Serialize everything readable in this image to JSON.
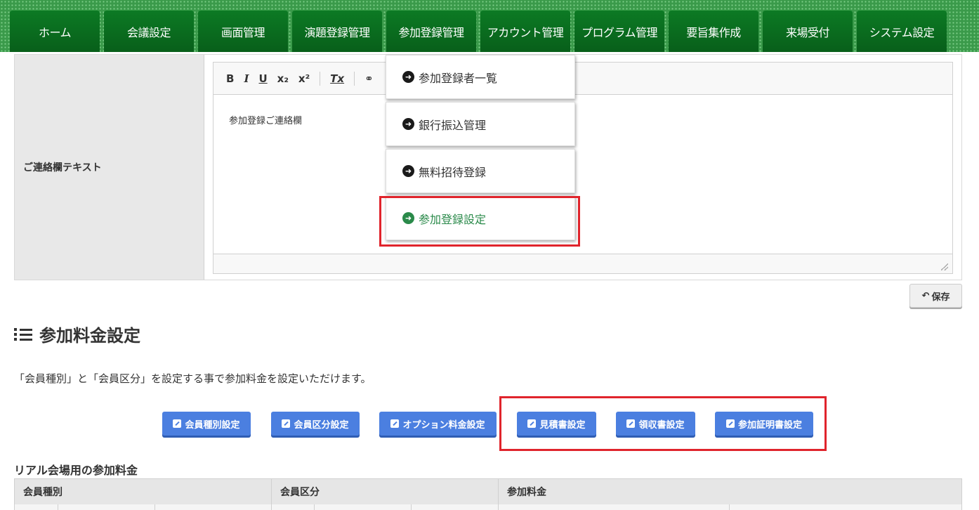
{
  "nav": {
    "items": [
      "ホーム",
      "会議設定",
      "画面管理",
      "演題登録管理",
      "参加登録管理",
      "アカウント管理",
      "プログラム管理",
      "要旨集作成",
      "来場受付",
      "システム設定"
    ]
  },
  "editor": {
    "label": "ご連絡欄テキスト",
    "toolbar": [
      "B",
      "I",
      "U",
      "x₂",
      "x²",
      "Tx",
      "⚭"
    ],
    "content": "参加登録ご連絡欄"
  },
  "dropdown": {
    "items": [
      {
        "label": "参加登録者一覧",
        "active": false
      },
      {
        "label": "銀行振込管理",
        "active": false
      },
      {
        "label": "無料招待登録",
        "active": false
      },
      {
        "label": "参加登録設定",
        "active": true
      }
    ]
  },
  "save_label": "保存",
  "section_title": "参加料金設定",
  "description": "「会員種別」と「会員区分」を設定する事で参加料金を設定いただけます。",
  "buttons": [
    "会員種別設定",
    "会員区分設定",
    "オプション料金設定",
    "見積書設定",
    "領収書設定",
    "参加証明書設定"
  ],
  "fee_section": {
    "title": "リアル会場用の参加料金",
    "headers": [
      "会員種別",
      "会員区分",
      "参加料金"
    ]
  },
  "colors": {
    "nav_green": "#0c7a24",
    "highlight_red": "#e0242c",
    "button_blue": "#4b7fe0",
    "active_green": "#2a8a4a"
  }
}
